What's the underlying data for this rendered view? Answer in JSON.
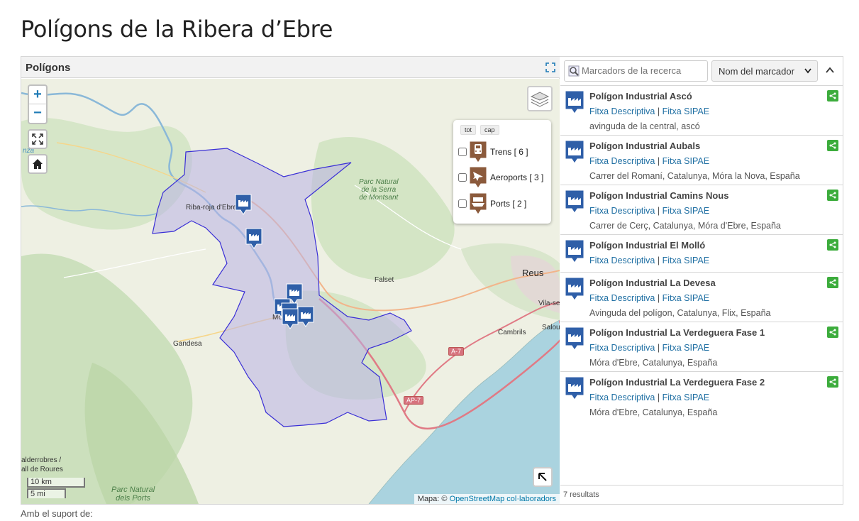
{
  "page": {
    "title": "Polígons de la Ribera d’Ebre",
    "footer": "Amb el suport de:"
  },
  "map": {
    "header_title": "Polígons",
    "zoom_in": "+",
    "zoom_out": "−",
    "legend": {
      "btn_all": "tot",
      "btn_none": "cap",
      "rows": [
        {
          "label": "Trens [ 6 ]",
          "icon": "train-icon"
        },
        {
          "label": "Aeroports [ 3 ]",
          "icon": "airplane-icon"
        },
        {
          "label": "Ports [ 2 ]",
          "icon": "ship-icon"
        }
      ]
    },
    "scale_km": "10 km",
    "scale_mi": "5 mi",
    "attribution_prefix": "Mapa: © ",
    "attribution_link": "OpenStreetMap col·laboradors",
    "place_labels": {
      "ribaroja": "Riba-roja d'Ebre",
      "gandesa": "Gandesa",
      "falset": "Falset",
      "reus": "Reus",
      "cambrils": "Cambrils",
      "vilase": "Vila-se",
      "salou": "Salou",
      "mo": "Mó",
      "nza": "nza",
      "valderrobres": "alderrobres /",
      "vallderoures": "all de Roures",
      "parc_montsant": "Parc Natural\nde la Serra\nde Montsant",
      "parc_ports": "Parc Natural\ndels Ports"
    },
    "roads": {
      "a7": "A-7",
      "ap7": "AP-7"
    }
  },
  "list": {
    "search_placeholder": "Marcadors de la recerca",
    "sort_selected": "Nom del marcador",
    "link_descriptiva": "Fitxa Descriptiva",
    "link_sep": "|",
    "link_sipae": "Fitxa SIPAE",
    "items": [
      {
        "name": "Polígon Industrial Ascó",
        "address": "avinguda de la central, ascó"
      },
      {
        "name": "Polígon Industrial Aubals",
        "address": "Carrer del Romaní, Catalunya, Móra la Nova, España"
      },
      {
        "name": "Polígon Industrial Camins Nous",
        "address": "Carrer de Cerç, Catalunya, Móra d'Ebre, España"
      },
      {
        "name": "Polígon Industrial El Molló",
        "address": ""
      },
      {
        "name": "Polígon Industrial La Devesa",
        "address": "Avinguda del polígon, Catalunya, Flix, España"
      },
      {
        "name": "Polígon Industrial La Verdeguera Fase 1",
        "address": "Móra d'Ebre, Catalunya, España"
      },
      {
        "name": "Polígon Industrial La Verdeguera Fase 2",
        "address": "Móra d'Ebre, Catalunya, España"
      }
    ],
    "results": "7 resultats"
  },
  "colors": {
    "marker_blue": "#2f5fa8",
    "polygon_stroke": "#3a2fd6",
    "polygon_fill": "#b9b2e6",
    "sea": "#aad3df",
    "share_green": "#3cac3c",
    "link_blue": "#1f6fa3"
  }
}
